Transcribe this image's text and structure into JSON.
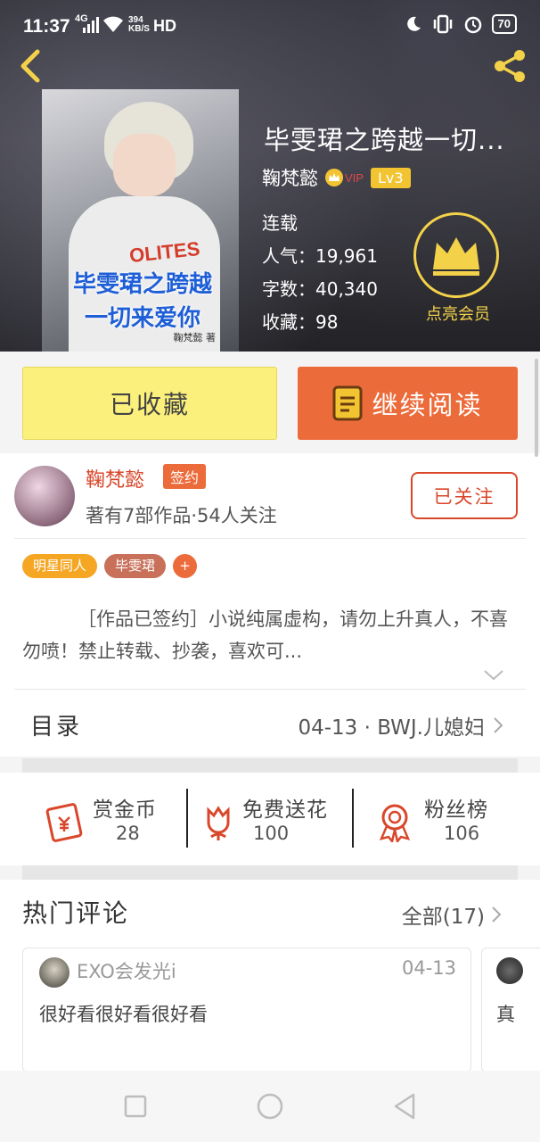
{
  "status_bar": {
    "time": "11:37",
    "network": "4G",
    "speed_value": "394",
    "speed_unit": "KB/S",
    "hd": "HD",
    "battery": "70"
  },
  "book": {
    "cover_brand": "OLITES",
    "cover_title": "毕雯珺之跨越\n一切来爱你",
    "cover_author": "鞠梵懿 著",
    "title": "毕雯珺之跨越一切...",
    "author": "鞠梵懿",
    "vip_label": "VIP",
    "level": "Lv3",
    "status": "连载",
    "popularity": "人气：19,961",
    "word_count": "字数：40,340",
    "favorites": "收藏：98",
    "member_label": "点亮会员"
  },
  "actions": {
    "collected_label": "已收藏",
    "continue_label": "继续阅读"
  },
  "author_card": {
    "name": "鞠梵懿",
    "signed_label": "签约",
    "works": "著有7部作品·54人关注",
    "follow_label": "已关注"
  },
  "tags": [
    "明星同人",
    "毕雯珺",
    "+"
  ],
  "description": "［作品已签约］小说纯属虚构，请勿上升真人，不喜勿喷！禁止转载、抄袭，喜欢可...",
  "toc": {
    "label": "目录",
    "latest": "04-13 · BWJ.儿媳妇"
  },
  "rewards": [
    {
      "label": "赏金币",
      "count": "28",
      "icon": "red-envelope-icon"
    },
    {
      "label": "免费送花",
      "count": "100",
      "icon": "flower-icon"
    },
    {
      "label": "粉丝榜",
      "count": "106",
      "icon": "medal-icon"
    }
  ],
  "comments": {
    "title": "热门评论",
    "all_label": "全部(17)",
    "items": [
      {
        "user": "EXO会发光i",
        "date": "04-13",
        "text": "很好看很好看很好看"
      },
      {
        "text": "真"
      }
    ]
  },
  "colors": {
    "accent_orange": "#ec6b3a",
    "accent_red": "#d9472b",
    "gold": "#f3d24a",
    "yellow_button": "#fbf07b"
  }
}
